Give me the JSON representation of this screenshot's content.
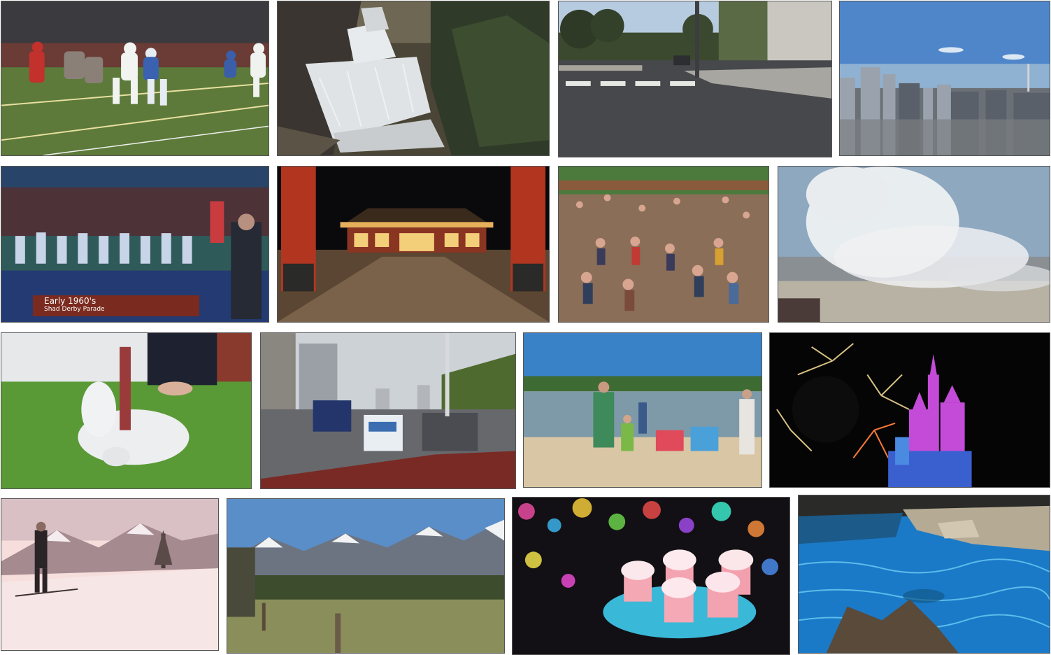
{
  "tiles": [
    {
      "name": "football-game-tile",
      "subject": "night football game"
    },
    {
      "name": "waterfall-tile",
      "subject": "forest waterfall"
    },
    {
      "name": "street-intersection-tile",
      "subject": "suburban street crosswalk"
    },
    {
      "name": "city-skyline-tile",
      "subject": "aerial city skyline"
    },
    {
      "name": "parade-tile",
      "subject": "marching band parade",
      "caption": {
        "line1": "Early 1960's",
        "line2": "Shad Derby Parade"
      }
    },
    {
      "name": "temple-night-tile",
      "subject": "temple courtyard at night"
    },
    {
      "name": "mud-field-tile",
      "subject": "crowd playing in mud"
    },
    {
      "name": "geyser-tile",
      "subject": "steaming geyser"
    },
    {
      "name": "dog-on-grass-tile",
      "subject": "white dog rolling on grass"
    },
    {
      "name": "city-road-tile",
      "subject": "road traffic with taxi"
    },
    {
      "name": "beach-tile",
      "subject": "families on a lake beach"
    },
    {
      "name": "fireworks-castle-tile",
      "subject": "fireworks over castle"
    },
    {
      "name": "skier-tile",
      "subject": "vintage skier on snowy slope"
    },
    {
      "name": "mountain-meadow-tile",
      "subject": "alpine valley with mountains"
    },
    {
      "name": "cupcakes-tile",
      "subject": "cupcakes with confetti"
    },
    {
      "name": "pool-tile",
      "subject": "blue pool with rocks"
    }
  ]
}
